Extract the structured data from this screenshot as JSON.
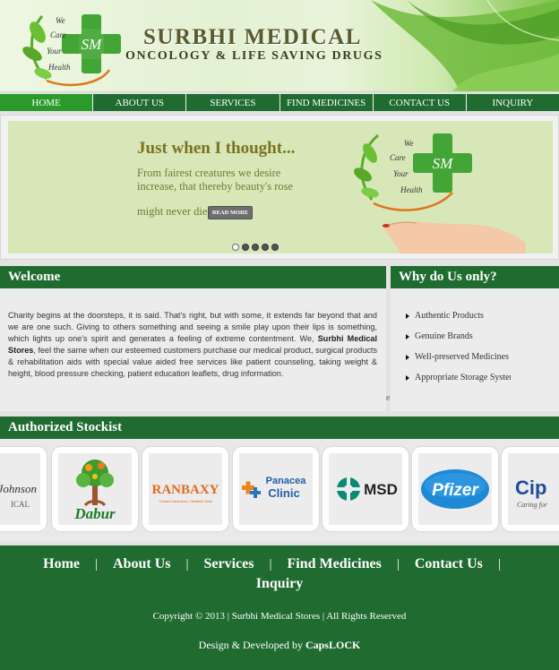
{
  "header": {
    "logo_text": [
      "We",
      "Care",
      "Your",
      "Health"
    ],
    "logo_monogram": "SM",
    "title": "SURBHI MEDICAL",
    "subtitle": "ONCOLOGY  &  LIFE  SAVING  DRUGS"
  },
  "nav": {
    "items": [
      {
        "label": "HOME",
        "active": true
      },
      {
        "label": "ABOUT US"
      },
      {
        "label": "SERVICES"
      },
      {
        "label": "FIND MEDICINES"
      },
      {
        "label": "CONTACT US"
      },
      {
        "label": "INQUIRY"
      }
    ]
  },
  "slider": {
    "title": "Just when I thought...",
    "text": "From fairest creatures we desire increase, that thereby beauty's rose",
    "text2": "might never die",
    "button": "READ MORE",
    "dots": 5,
    "active_dot": 0
  },
  "welcome": {
    "heading": "Welcome",
    "text_before": "Charity begins at the doorsteps, it is said. That's right, but with some, it extends far beyond that and we are one such.  Giving to others something and seeing a smile play upon their lips is something, which lights up one's spirit and generates a feeling of extreme contentment. We, ",
    "text_bold": "Surbhi Medical Stores",
    "text_after": ", feel the same when our esteemed customers purchase our medical product, surgical products & rehabilitation aids with special value aided free services like patient counseling, taking weight & height, blood pressure checking, patient education leaflets, drug information."
  },
  "why": {
    "heading": "Why do Us only?",
    "items": [
      "Authentic Products",
      "Genuine Brands",
      "Well-preserved Medicines",
      "Appropriate Storage System"
    ],
    "overflow_char": "e"
  },
  "stockist": {
    "heading": "Authorized Stockist",
    "brands": [
      {
        "name": "Johnson Medical",
        "line1": "Johnson",
        "line2": "ICAL"
      },
      {
        "name": "Dabur",
        "text": "Dabur"
      },
      {
        "name": "Ranbaxy",
        "text": "RANBAXY",
        "tagline": "Trusted medicines. Healthier lives"
      },
      {
        "name": "Panacea Clinic",
        "line1": "Panacea",
        "line2": "Clinic"
      },
      {
        "name": "MSD",
        "text": "MSD"
      },
      {
        "name": "Pfizer",
        "text": "Pfizer"
      },
      {
        "name": "Cipla",
        "text": "Cip",
        "tagline": "Caring for"
      }
    ]
  },
  "footer": {
    "nav": [
      "Home",
      "About Us",
      "Services",
      "Find Medicines",
      "Contact Us",
      "Inquiry"
    ],
    "separator": "|",
    "copyright": "Copyright © 2013 |  Surbhi Medical Stores | All Rights Reserved",
    "design_prefix": "Design & Developed by ",
    "design_by": "CapsLOCK"
  },
  "colors": {
    "primary_green": "#1f6b30",
    "active_nav": "#2a9a2a",
    "slider_bg": "#d8e7b8",
    "cross_green": "#43a535"
  }
}
